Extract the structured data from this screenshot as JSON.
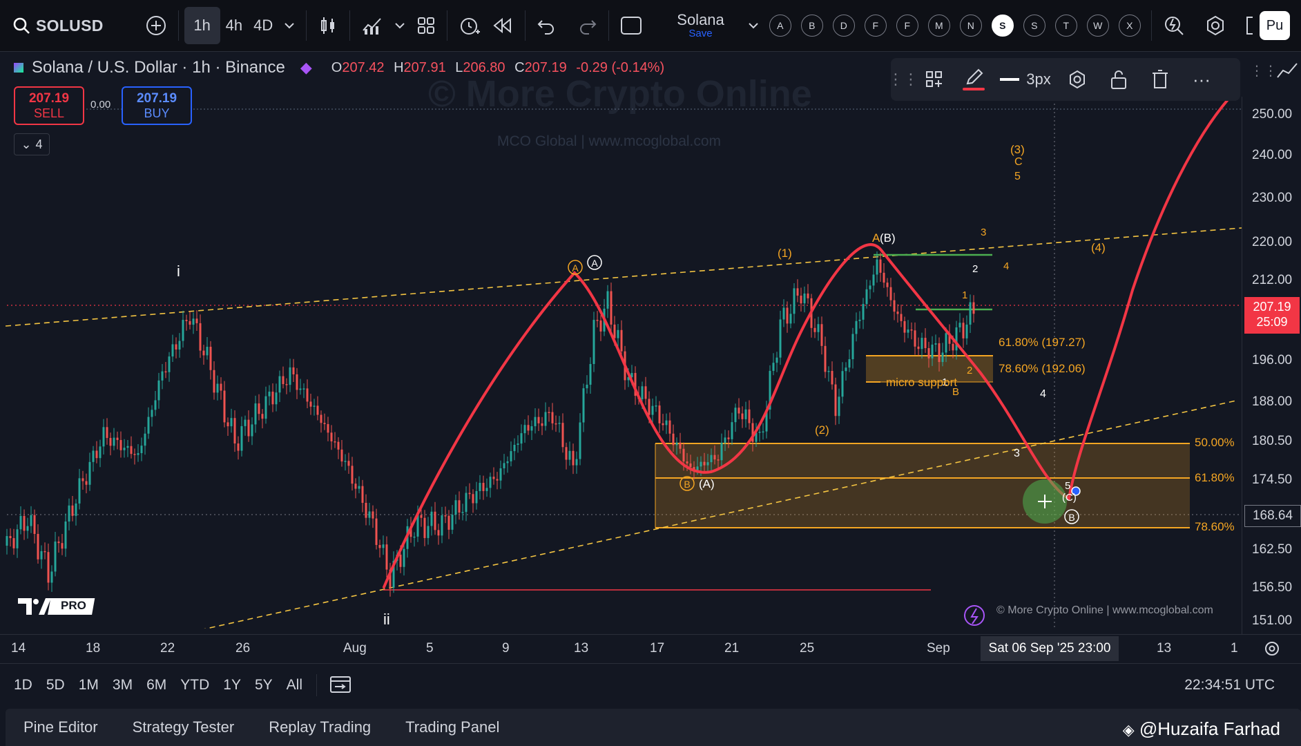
{
  "toolbar": {
    "symbol": "SOLUSD",
    "timeframes": [
      "1h",
      "4h",
      "4D"
    ],
    "active_timeframe": "1h",
    "layout_name": "Solana",
    "layout_status": "Save",
    "watchlist_letters": [
      "A",
      "B",
      "D",
      "F",
      "F",
      "M",
      "N",
      "S",
      "S",
      "T",
      "W",
      "X"
    ],
    "active_letter_index": 7,
    "publish_label": "Pu"
  },
  "legend": {
    "title": "Solana / U.S. Dollar · 1h · Binance",
    "open_key": "O",
    "open": "207.42",
    "high_key": "H",
    "high": "207.91",
    "low_key": "L",
    "low": "206.80",
    "close_key": "C",
    "close": "207.19",
    "change": "-0.29 (-0.14%)"
  },
  "trade": {
    "sell_price": "207.19",
    "sell_label": "SELL",
    "buy_price": "207.19",
    "buy_label": "BUY",
    "spread": "0.00",
    "collapse_label": "4"
  },
  "drawing_toolbar": {
    "width_label": "3px"
  },
  "price_axis": {
    "labels": [
      "250.00",
      "240.00",
      "230.00",
      "220.00",
      "212.00",
      "196.00",
      "188.00",
      "180.50",
      "174.50",
      "162.50",
      "156.50",
      "151.00"
    ],
    "current_price": "207.19",
    "countdown": "25:09",
    "crosshair_price": "168.64"
  },
  "time_axis": {
    "labels": [
      "14",
      "18",
      "22",
      "26",
      "Aug",
      "5",
      "9",
      "13",
      "17",
      "21",
      "25",
      "Sep",
      "13",
      "1"
    ],
    "crosshair_time": "Sat 06 Sep '25   23:00"
  },
  "annotations": {
    "wave_i": "i",
    "wave_ii": "ii",
    "A_circled_orange": "A",
    "A_circled_white": "A",
    "B_circled_orange": "B",
    "paren_A": "(A)",
    "wave_1": "(1)",
    "wave_2": "(2)",
    "wave_3": "(3)",
    "wave_C": "C",
    "wave_5": "5",
    "wave_4": "(4)",
    "wave_B_paren": "(B)",
    "wave_A_small": "A",
    "small_1": "1",
    "small_2": "2",
    "small_3": "3",
    "small_4": "4",
    "small_5": "5",
    "small_B": "B",
    "small_1b": "1",
    "small_2b": "2",
    "wave_3_white": "3",
    "wave_4_white": "4",
    "wave_5_white": "5",
    "wave_C_paren": "(C)",
    "wave_B_circled": "B",
    "fib_61": "61.80% (197.27)",
    "fib_78": "78.60% (192.06)",
    "micro_support": "micro support",
    "zone_50": "50.00%",
    "zone_61": "61.80%",
    "zone_78": "78.60%"
  },
  "watermark": {
    "main": "© More Crypto Online",
    "sub": "MCO Global   |   www.mcoglobal.com",
    "bottom": "© More Crypto Online   |   www.mcoglobal.com"
  },
  "logo_text": "PRO",
  "range_buttons": [
    "1D",
    "5D",
    "1M",
    "3M",
    "6M",
    "YTD",
    "1Y",
    "5Y",
    "All"
  ],
  "clock": "22:34:51 UTC",
  "bottom_tabs": [
    "Pine Editor",
    "Strategy Tester",
    "Replay Trading",
    "Trading Panel"
  ],
  "credit": "@Huzaifa Farhad",
  "colors": {
    "up": "#26a69a",
    "down": "#ef5350",
    "path": "#f23645",
    "fib": "#f5a623",
    "bg": "#131722"
  }
}
